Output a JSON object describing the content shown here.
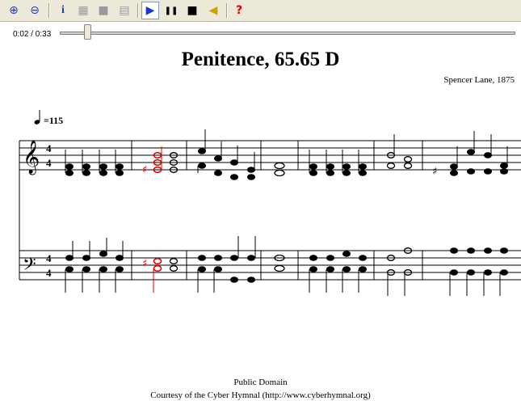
{
  "toolbar": {
    "buttons": [
      {
        "name": "zoom-in-icon",
        "glyph": "⊕",
        "color": "#1f3f9f"
      },
      {
        "name": "zoom-out-icon",
        "glyph": "⊖",
        "color": "#1f3f9f"
      },
      {
        "name": "info-icon",
        "glyph": "i",
        "color": "#1f3f9f"
      },
      {
        "name": "piano-icon",
        "glyph": "▦",
        "color": "#9a9a9a"
      },
      {
        "name": "save-icon",
        "glyph": "■",
        "color": "#9a9a9a"
      },
      {
        "name": "print-icon",
        "glyph": "▤",
        "color": "#9a9a9a"
      },
      {
        "name": "play-icon",
        "glyph": "▶",
        "color": "#1236d8"
      },
      {
        "name": "pause-icon",
        "glyph": "❚❚",
        "color": "#000000"
      },
      {
        "name": "stop-icon",
        "glyph": "■",
        "color": "#000000"
      },
      {
        "name": "volume-icon",
        "glyph": "◀",
        "color": "#c9a200"
      },
      {
        "name": "help-icon",
        "glyph": "?",
        "color": "#e00000"
      }
    ]
  },
  "player": {
    "time": "0:02 / 0:33",
    "progress": 0.06
  },
  "score": {
    "title": "Penitence, 65.65 D",
    "composer": "Spencer Lane, 1875",
    "tempo_value": "=115",
    "time_signature": [
      "4",
      "4"
    ]
  },
  "footer": {
    "line1": "Public Domain",
    "line2": "Courtesy of the Cyber Hymnal (http://www.cyberhymnal.org)"
  },
  "colors": {
    "highlight": "#e00000",
    "accent": "#1236d8"
  }
}
